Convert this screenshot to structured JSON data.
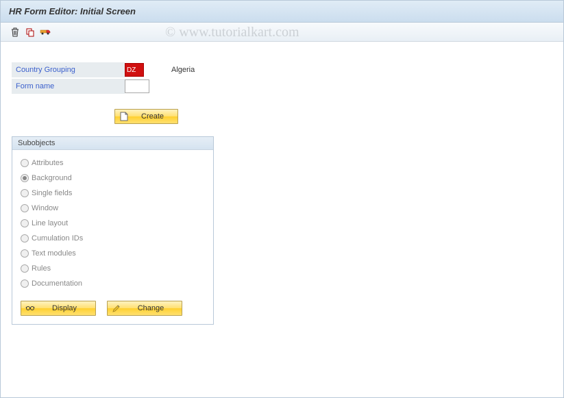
{
  "title": "HR Form Editor: Initial Screen",
  "watermark": "© www.tutorialkart.com",
  "fields": {
    "country_grouping": {
      "label": "Country Grouping",
      "value": "DZ",
      "desc": "Algeria"
    },
    "form_name": {
      "label": "Form name",
      "value": ""
    }
  },
  "buttons": {
    "create": "Create",
    "display": "Display",
    "change": "Change"
  },
  "subobjects": {
    "title": "Subobjects",
    "items": [
      {
        "label": "Attributes",
        "selected": false
      },
      {
        "label": "Background",
        "selected": true
      },
      {
        "label": "Single fields",
        "selected": false
      },
      {
        "label": "Window",
        "selected": false
      },
      {
        "label": "Line layout",
        "selected": false
      },
      {
        "label": "Cumulation IDs",
        "selected": false
      },
      {
        "label": "Text modules",
        "selected": false
      },
      {
        "label": "Rules",
        "selected": false
      },
      {
        "label": "Documentation",
        "selected": false
      }
    ]
  }
}
